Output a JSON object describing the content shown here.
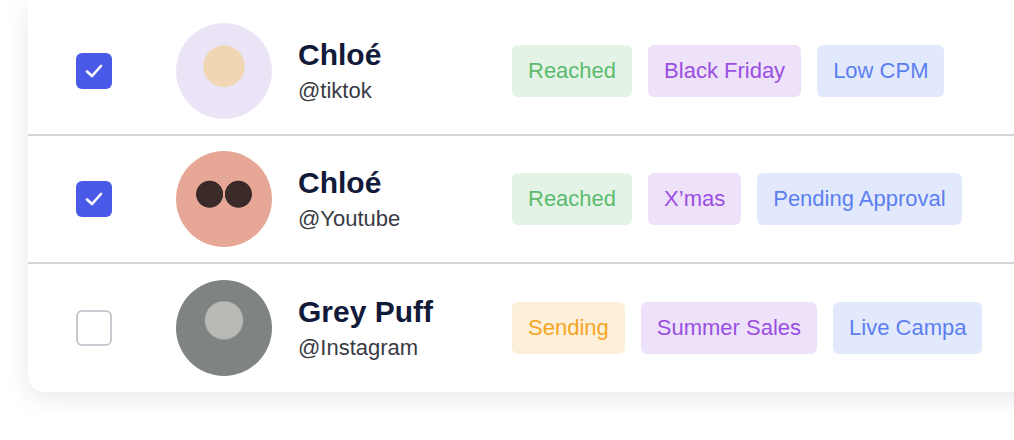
{
  "rows": [
    {
      "checked": true,
      "name": "Chloé",
      "handle": "@tiktok",
      "tags": [
        {
          "label": "Reached",
          "color": "#5dbb6e"
        },
        {
          "label": "Black Friday",
          "color": "#9a4fe0"
        },
        {
          "label": "Low CPM",
          "color": "#5b7ff0"
        }
      ]
    },
    {
      "checked": true,
      "name": "Chloé",
      "handle": "@Youtube",
      "tags": [
        {
          "label": "Reached",
          "color": "#5dbb6e"
        },
        {
          "label": "X’mas",
          "color": "#9a4fe0"
        },
        {
          "label": "Pending Approval",
          "color": "#5b7ff0"
        }
      ]
    },
    {
      "checked": false,
      "name": "Grey Puff",
      "handle": "@Instagram",
      "tags": [
        {
          "label": "Sending",
          "color": "#f5a623"
        },
        {
          "label": "Summer Sales",
          "color": "#9a4fe0"
        },
        {
          "label": "Live Campa",
          "color": "#5b7ff0"
        }
      ]
    }
  ]
}
